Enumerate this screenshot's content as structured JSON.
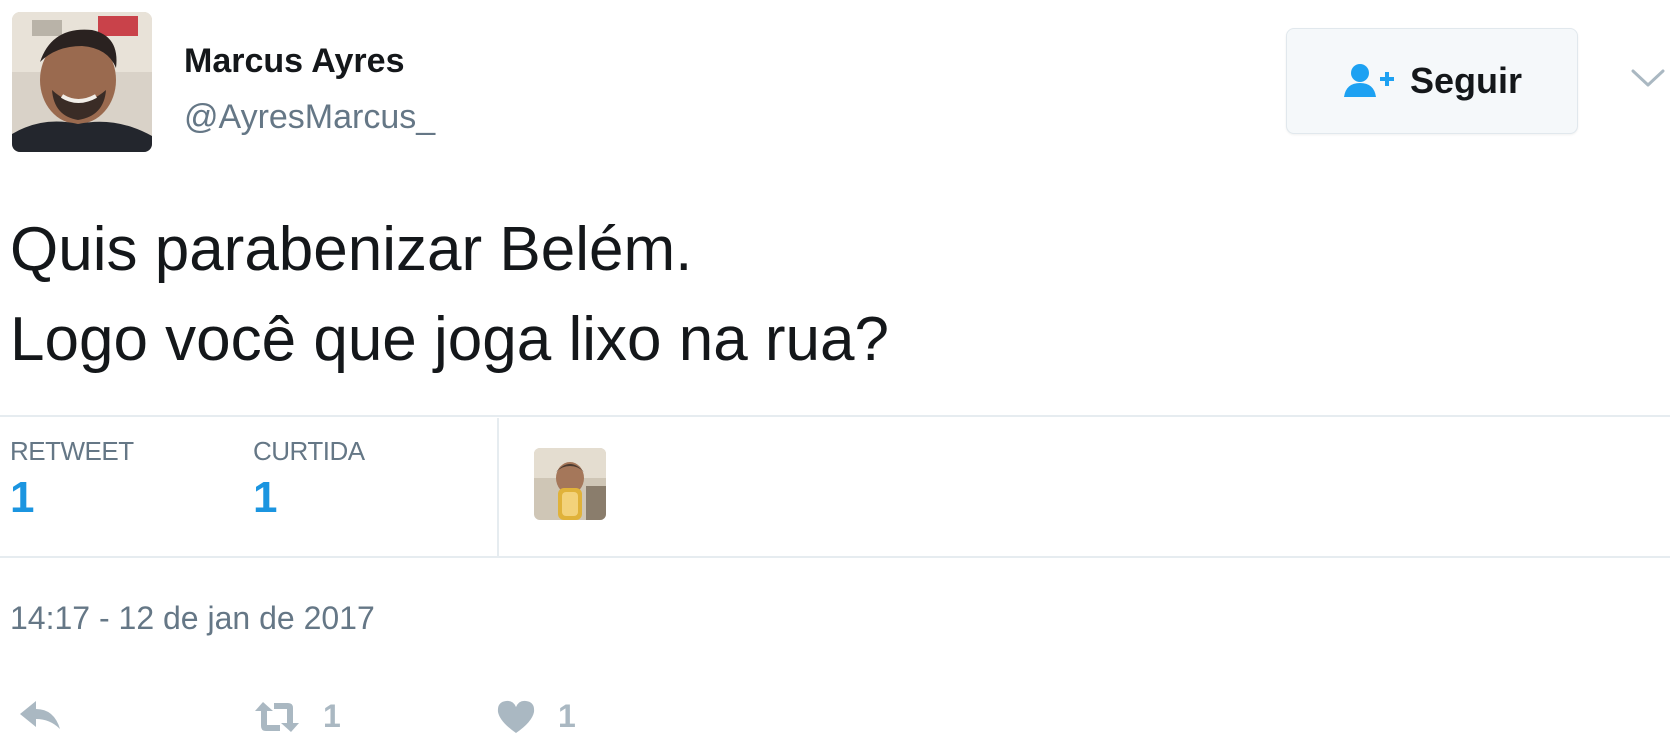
{
  "author": {
    "display_name": "Marcus Ayres",
    "handle": "@AyresMarcus_"
  },
  "follow_button": {
    "label": "Seguir"
  },
  "tweet": {
    "lines": [
      "Quis parabenizar Belém.",
      "Logo você que joga lixo na rua?"
    ],
    "timestamp": "14:17 - 12 de jan de 2017"
  },
  "stats": {
    "retweets": {
      "label": "RETWEET",
      "value": "1"
    },
    "likes": {
      "label": "CURTIDA",
      "value": "1"
    }
  },
  "actions": {
    "reply": {
      "icon": "reply-icon"
    },
    "retweet": {
      "icon": "retweet-icon",
      "count": "1"
    },
    "like": {
      "icon": "heart-icon",
      "count": "1"
    }
  },
  "colors": {
    "accent": "#1b95e0",
    "text": "#14171a",
    "muted": "#657786",
    "icon_muted": "#aab8c2",
    "divider": "#e6ecf0"
  }
}
